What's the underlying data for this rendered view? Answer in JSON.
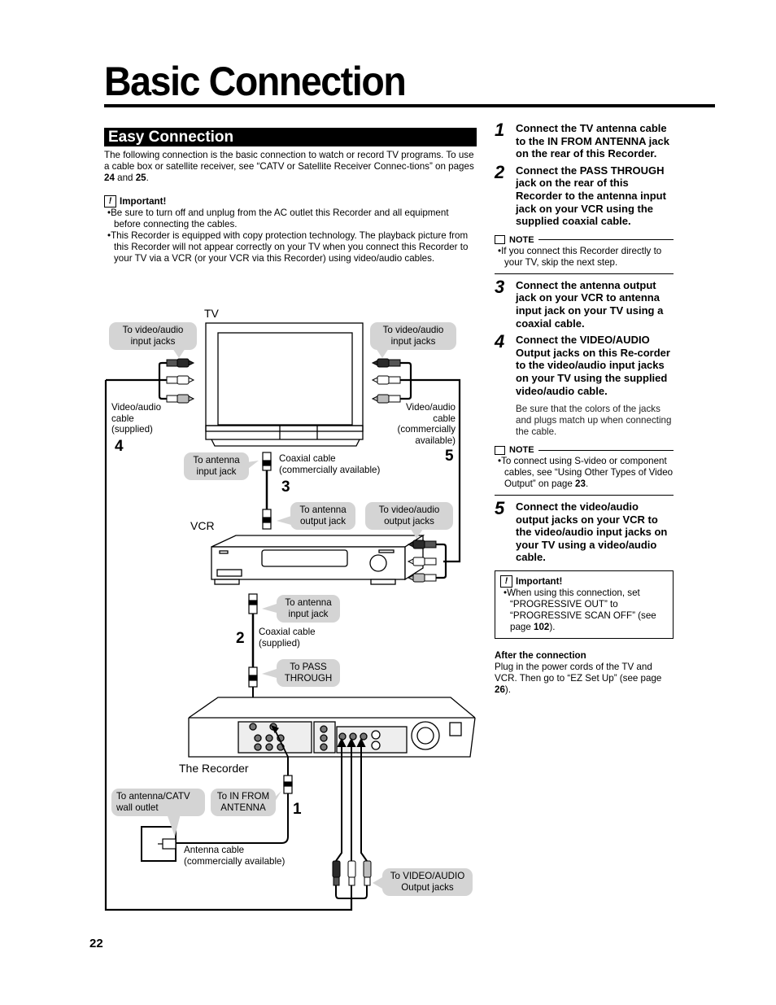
{
  "page": {
    "title": "Basic Connection",
    "page_number": "22"
  },
  "left": {
    "section_title": "Easy Connection",
    "intro": "The following connection is the basic connection to watch or record TV programs. To use a cable box or satellite receiver, see “CATV or Satellite Receiver Connec-tions” on pages",
    "intro_page_a": "24",
    "intro_and": "and",
    "intro_page_b": "25",
    "important": {
      "icon": "exclamation-icon",
      "heading": "Important!",
      "bullets": [
        "Be sure to turn off and unplug from the AC outlet this Recorder and all equipment before connecting the cables.",
        "This Recorder is equipped with copy protection technology. The playback picture from this Recorder will not appear correctly on your TV when you connect this Recorder to your TV via a VCR (or your VCR via this Recorder) using video/audio cables."
      ]
    }
  },
  "diagram": {
    "devices": {
      "tv": "TV",
      "vcr": "VCR",
      "recorder": "The Recorder"
    },
    "callouts": {
      "tv_left_input": "To video/audio input jacks",
      "tv_right_input": "To video/audio input jacks",
      "tv_antenna_input": "To antenna input jack",
      "vcr_antenna_output": "To antenna output jack",
      "vcr_av_output": "To video/audio output jacks",
      "vcr_antenna_input": "To antenna input jack",
      "pass_through": "To PASS THROUGH",
      "wall_outlet": "To antenna/CATV wall outlet",
      "in_from_antenna": "To IN FROM ANTENNA",
      "rec_av_output": "To VIDEO/AUDIO Output jacks"
    },
    "labels": {
      "cable_left": "Video/audio cable (supplied)",
      "cable_right": "Video/audio cable (commercially available)",
      "coax_top": "Coaxial cable (commercially available)",
      "coax_mid": "Coaxial cable (supplied)",
      "antenna_cable": "Antenna cable (commercially available)"
    },
    "step_numbers": [
      "1",
      "2",
      "3",
      "4",
      "5"
    ],
    "plug_colors": {
      "video": "#2a2a2a",
      "audio_l": "#ffffff",
      "audio_r": "#bdbdbd"
    }
  },
  "steps": [
    {
      "num": "1",
      "text": "Connect the TV antenna cable to the IN FROM ANTENNA jack on the rear of this Recorder."
    },
    {
      "num": "2",
      "text": "Connect the PASS THROUGH jack on the rear of this Recorder to the antenna input jack on your VCR using the supplied coaxial cable."
    },
    {
      "num": "3",
      "text": "Connect the antenna output jack on your VCR to antenna input jack on your TV using a coaxial cable."
    },
    {
      "num": "4",
      "text": "Connect the VIDEO/AUDIO Output jacks on this Re-corder to the video/audio input jacks on your TV using the supplied video/audio cable.",
      "sub": "Be sure that the colors of the jacks and plugs match up when connecting the cable."
    },
    {
      "num": "5",
      "text": "Connect the video/audio output jacks on your VCR to the video/audio input jacks on your TV using a video/audio cable."
    }
  ],
  "notes": [
    {
      "heading": "NOTE",
      "icon": "note-icon",
      "text": "If you connect this Recorder directly to your TV, skip the next step."
    },
    {
      "heading": "NOTE",
      "icon": "note-icon",
      "text": "To connect using S-video or component cables, see “Using Other Types of Video Output” on page",
      "page": "23"
    }
  ],
  "important_right": {
    "icon": "exclamation-icon",
    "heading": "Important!",
    "text": "When using this connection, set “PROGRESSIVE OUT” to “PROGRESSIVE SCAN OFF” (see page",
    "page": "102"
  },
  "after": {
    "heading": "After the connection",
    "text": "Plug in the power cords of the TV and VCR. Then go to “EZ Set Up” (see page",
    "page": "26"
  }
}
